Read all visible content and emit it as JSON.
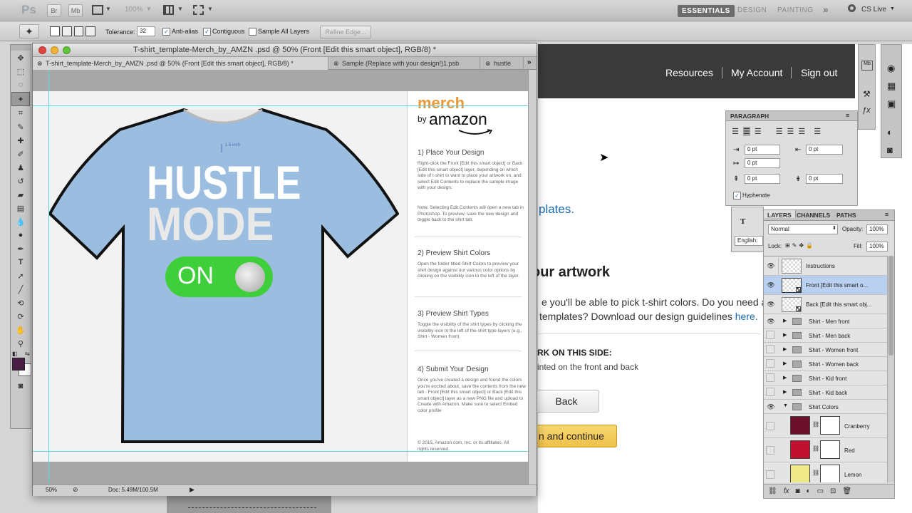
{
  "appbar": {
    "logo": "Ps",
    "br": "Br",
    "mb": "Mb",
    "zoom": "100%",
    "workspaces": [
      "ESSENTIALS",
      "DESIGN",
      "PAINTING"
    ],
    "more": "»",
    "cslive": "CS Live"
  },
  "options": {
    "tolerance_label": "Tolerance:",
    "tolerance_value": "32",
    "antialias": "Anti-alias",
    "contiguous": "Contiguous",
    "sample_all": "Sample All Layers",
    "refine_edge": "Refine Edge..."
  },
  "web": {
    "nav": [
      "Resources",
      "My Account",
      "Sign out"
    ],
    "plates": "plates.",
    "heading": "our artwork",
    "para1": "e you'll be able to pick t-shirt colors. Do you need a",
    "para2": "templates? Download our design guidelines",
    "here": "here.",
    "side_heading": "RK ON THIS SIDE:",
    "side_text": "inted on the front and back",
    "back_button": "Back",
    "continue_button": "n and continue"
  },
  "doc": {
    "title": "T-shirt_template-Merch_by_AMZN .psd @ 50% (Front [Edit this smart object], RGB/8) *",
    "tabs": [
      "T-shirt_template-Merch_by_AMZN .psd @ 50% (Front [Edit this smart object], RGB/8) *",
      "Sample (Replace with your design!)1.psb",
      "hustle"
    ],
    "shirt_line1": "HUSTLE",
    "shirt_line2": "MODE",
    "switch_text": "ON",
    "measure": "1.5 inch",
    "zoom": "50%",
    "doc_size": "Doc: 5.49M/100.5M",
    "logo_merch": "merch",
    "logo_by": "by",
    "logo_amazon": "amazon",
    "steps": [
      {
        "h": "1) Place Your Design",
        "p": "Right-click the Front [Edit this smart object] or Back [Edit this smart object] layer, depending on which side of t-shirt to want to place your artwork on, and select Edit Contents to replace the sample image with your design.",
        "p2": "Note: Selecting Edit Contents will open a new tab in Photoshop. To preview: save the new design and toggle back to the shirt tab."
      },
      {
        "h": "2) Preview Shirt Colors",
        "p": "Open the folder titled Shirt Colors to preview your shirt design against our various color options by clicking on the visibility icon to the left of the layer.",
        "p2": ""
      },
      {
        "h": "3) Preview Shirt Types",
        "p": "Toggle the visibility of the shirt types by clicking the visibility icon to the left of the shirt type layers (e.g., Shirt - Women front).",
        "p2": ""
      },
      {
        "h": "4) Submit Your Design",
        "p": "Once you've created a design and found the colors you're excited about, save the contents from the new tab - Front [Edit this smart object] or Back [Edit this smart object] layer as a new PNG file and upload to Create with Amazon. Make sure to select Embed color profile",
        "p2": ""
      }
    ],
    "copyright": "© 2015, Amazon.com, Inc. or its affiliates. All rights reserved."
  },
  "paragraph": {
    "title": "PARAGRAPH",
    "v1": "0 pt",
    "v2": "0 pt",
    "v3": "0 pt",
    "v4": "0 pt",
    "v5": "0 pt",
    "hyphenate": "Hyphenate",
    "english": "English:"
  },
  "layers": {
    "tabs": [
      "LAYERS",
      "CHANNELS",
      "PATHS"
    ],
    "blend": "Normal",
    "opacity_label": "Opacity:",
    "opacity": "100%",
    "lock_label": "Lock:",
    "fill_label": "Fill:",
    "fill": "100%",
    "items": [
      {
        "name": "Instructions",
        "visible": true,
        "type": "thumb"
      },
      {
        "name": "Front [Edit this smart o...",
        "visible": true,
        "type": "smart",
        "selected": true
      },
      {
        "name": "Back [Edit this smart obj...",
        "visible": true,
        "type": "smart"
      },
      {
        "name": "Shirt - Men front",
        "visible": true,
        "type": "folder"
      },
      {
        "name": "Shirt - Men back",
        "visible": false,
        "type": "folder"
      },
      {
        "name": "Shirt - Women front",
        "visible": false,
        "type": "folder"
      },
      {
        "name": "Shirt - Women back",
        "visible": false,
        "type": "folder"
      },
      {
        "name": "Shirt - Kid front",
        "visible": false,
        "type": "folder"
      },
      {
        "name": "Shirt - Kid back",
        "visible": false,
        "type": "folder"
      },
      {
        "name": "Shirt Colors",
        "visible": true,
        "type": "folder-open"
      }
    ],
    "colors": [
      {
        "name": "Cranberry",
        "hex": "#6b0f2a"
      },
      {
        "name": "Red",
        "hex": "#c0102f"
      },
      {
        "name": "Lemon",
        "hex": "#efe98a"
      }
    ]
  },
  "colors": {
    "shirt": "#9bbde0",
    "switch": "#3ecf3a",
    "merch_orange": "#e9983a",
    "layer_selected": "#b9d0f0",
    "fg_swatch": "#4b1f45"
  }
}
